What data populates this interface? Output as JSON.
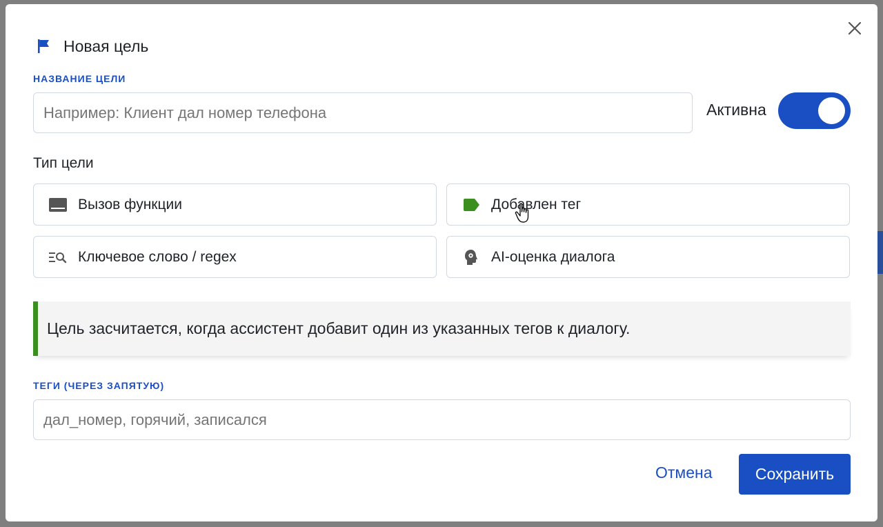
{
  "colors": {
    "accent": "#1a4fc4",
    "success": "#3a8f1e",
    "info_bg": "#f4f4f4"
  },
  "modal": {
    "title": "Новая цель",
    "title_icon": "flag-icon",
    "close_icon": "close-icon"
  },
  "goal_name": {
    "label": "НАЗВАНИЕ ЦЕЛИ",
    "placeholder": "Например: Клиент дал номер телефона",
    "value": ""
  },
  "active_toggle": {
    "label": "Активна",
    "state": "on"
  },
  "goal_type": {
    "label": "Тип цели",
    "options": [
      {
        "label": "Вызов функции",
        "icon": "function-icon"
      },
      {
        "label": "Добавлен тег",
        "icon": "tag-icon"
      },
      {
        "label": "Ключевое слово / regex",
        "icon": "keyword-search-icon"
      },
      {
        "label": "AI-оценка диалога",
        "icon": "ai-head-icon"
      }
    ]
  },
  "info": {
    "text": "Цель засчитается, когда ассистент добавит один из указанных тегов к диалогу."
  },
  "tags": {
    "label": "ТЕГИ (ЧЕРЕЗ ЗАПЯТУЮ)",
    "placeholder": "дал_номер, горячий, записался",
    "value": ""
  },
  "buttons": {
    "cancel": "Отмена",
    "save": "Сохранить"
  }
}
